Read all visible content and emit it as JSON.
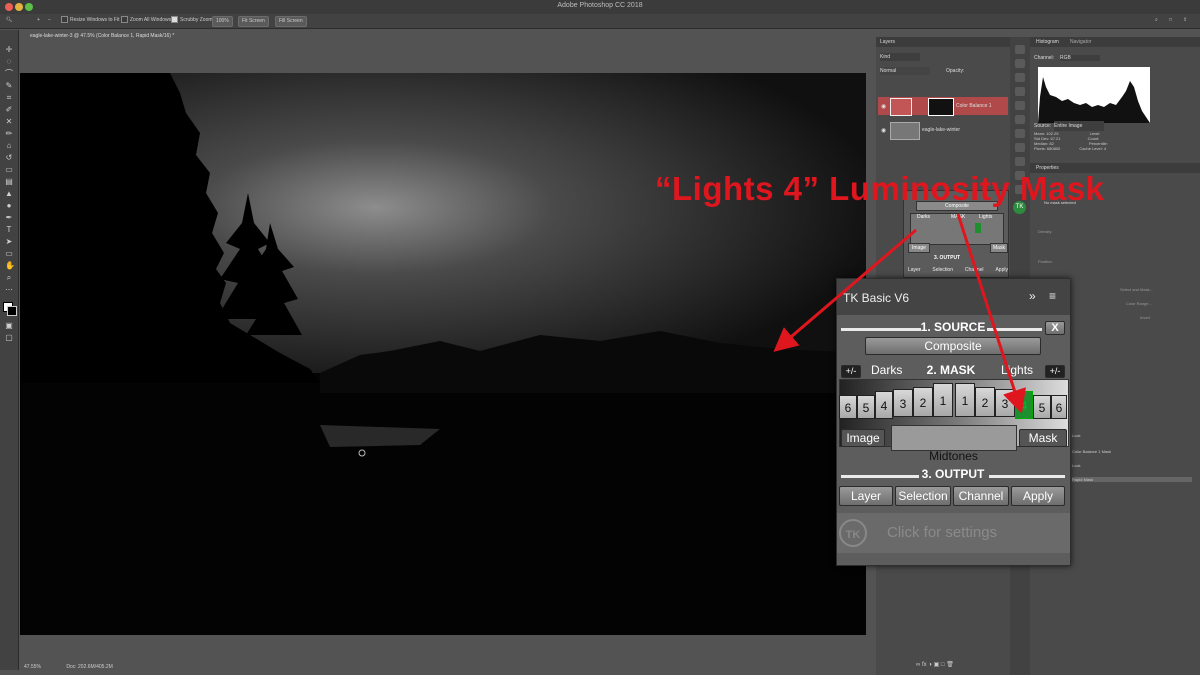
{
  "app": {
    "title": "Adobe Photoshop CC 2018"
  },
  "options_bar": {
    "resize_windows": "Resize Windows to Fit",
    "zoom_all": "Zoom All Windows",
    "scrubby_zoom": "Scrubby Zoom",
    "zoom_value": "100%",
    "fit_screen": "Fit Screen",
    "fill_screen": "Fill Screen"
  },
  "document": {
    "tab_title": "eagle-lake-winter-3 @ 47.5% (Color Balance 1, Rapid Mask/16) *",
    "zoom": "47.55%",
    "doc_info": "Doc: 202.6M/405.2M"
  },
  "layers_panel": {
    "tab": "Layers",
    "kind": "Kind",
    "blend": "Normal",
    "opacity": "Opacity:",
    "layers": [
      {
        "name": "Color Balance 1"
      },
      {
        "name": "eagle-lake-winter"
      }
    ]
  },
  "mini_tk": {
    "composite": "Composite",
    "darks": "Darks",
    "mask_label": "MASK",
    "lights": "Lights",
    "image": "Image",
    "mask": "Mask",
    "output": "3. OUTPUT",
    "layer": "Layer",
    "selection": "Selection",
    "channel": "Channel",
    "apply": "Apply"
  },
  "histogram_panel": {
    "tab1": "Histogram",
    "tab2": "Navigator",
    "channel_label": "Channel:",
    "channel_value": "RGB",
    "source_label": "Source:",
    "source_value": "Entire Image",
    "stats": {
      "mean_label": "Mean:",
      "mean": "102.25",
      "stddev_label": "Std Dev:",
      "stddev": "67.21",
      "median_label": "Median:",
      "median": "82",
      "pixels_label": "Pixels:",
      "pixels": "680800",
      "level_label": "Level:",
      "count_label": "Count:",
      "percentile_label": "Percentile:",
      "cache_label": "Cache Level:",
      "cache": "4"
    }
  },
  "properties_panel": {
    "tab": "Properties",
    "no_mask": "No mask selected",
    "density": "Density:",
    "feather": "Feather:",
    "select_mask": "Select and Mask...",
    "color_range": "Color Range...",
    "invert": "Invert"
  },
  "channels_panel": {
    "items": [
      "Color Balance 1 Mask",
      "Rapid Mask"
    ],
    "partial": [
      "Lock",
      "Mask"
    ]
  },
  "tk_panel": {
    "title": "TK Basic V6",
    "source_header": "1. SOURCE",
    "close": "X",
    "composite": "Composite",
    "plusminus": "+/-",
    "darks": "Darks",
    "mask_header": "2. MASK",
    "lights": "Lights",
    "dark_nums": [
      "6",
      "5",
      "4",
      "3",
      "2",
      "1"
    ],
    "light_nums": [
      "1",
      "2",
      "3",
      "4",
      "5",
      "6"
    ],
    "image": "Image",
    "mask": "Mask",
    "midtones": "Midtones",
    "output_header": "3. OUTPUT",
    "layer": "Layer",
    "selection": "Selection",
    "channel": "Channel",
    "apply": "Apply",
    "logo": "TK",
    "settings": "Click for settings"
  },
  "annotation": {
    "text": "“Lights 4” Luminosity Mask"
  },
  "colors": {
    "accent_red": "#e0161f",
    "active_green": "#1e8f2e",
    "layer_selected": "#b04a4a"
  }
}
